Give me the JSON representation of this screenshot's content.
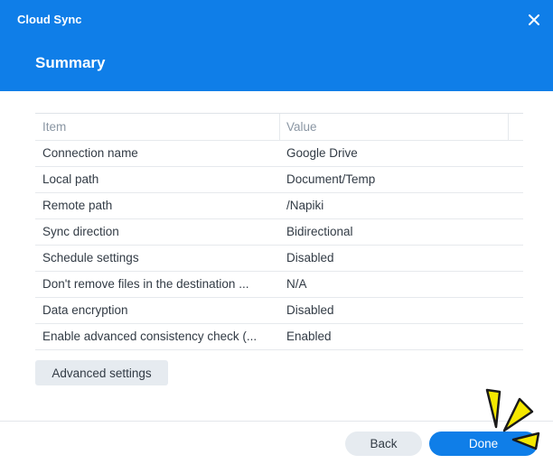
{
  "window": {
    "app_title": "Cloud Sync",
    "close_icon": "close-icon"
  },
  "header": {
    "title": "Summary"
  },
  "table": {
    "columns": [
      "Item",
      "Value"
    ],
    "rows": [
      {
        "item": "Connection name",
        "value": "Google Drive"
      },
      {
        "item": "Local path",
        "value": "Document/Temp"
      },
      {
        "item": "Remote path",
        "value": "/Napiki"
      },
      {
        "item": "Sync direction",
        "value": "Bidirectional"
      },
      {
        "item": "Schedule settings",
        "value": "Disabled"
      },
      {
        "item": "Don't remove files in the destination ...",
        "value": "N/A"
      },
      {
        "item": "Data encryption",
        "value": "Disabled"
      },
      {
        "item": "Enable advanced consistency check (...",
        "value": "Enabled"
      }
    ]
  },
  "buttons": {
    "advanced_settings": "Advanced settings",
    "back": "Back",
    "done": "Done"
  },
  "colors": {
    "accent": "#0f7ee8",
    "highlight": "#f5e800"
  }
}
